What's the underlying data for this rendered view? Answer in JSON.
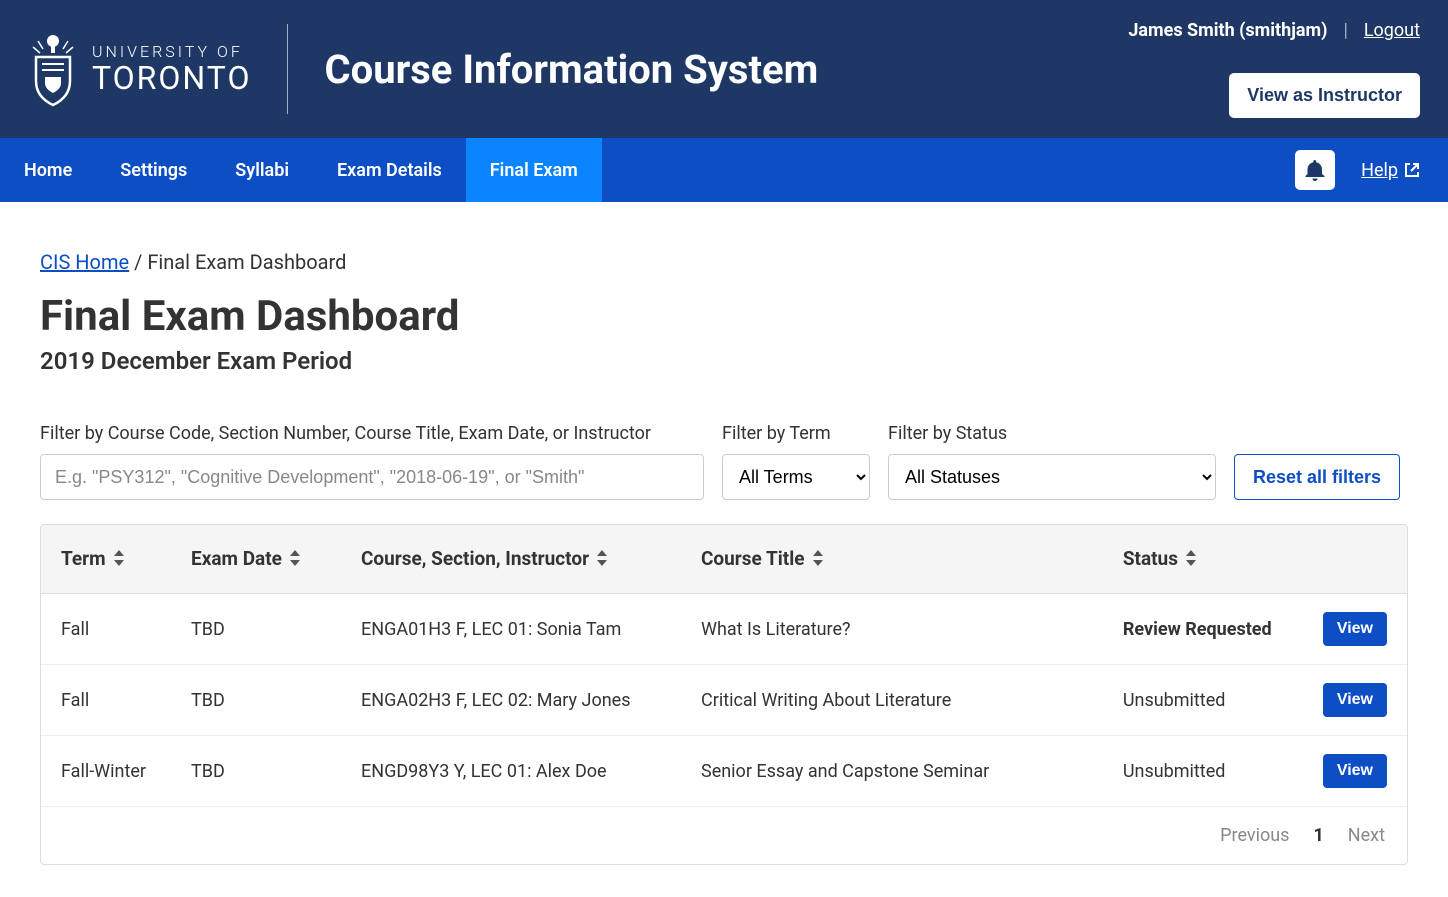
{
  "header": {
    "university_of": "UNIVERSITY OF",
    "toronto": "TORONTO",
    "app_title": "Course Information System",
    "user_display": "James Smith (smithjam)",
    "logout": "Logout",
    "view_as": "View as Instructor"
  },
  "nav": {
    "items": [
      {
        "label": "Home",
        "active": false
      },
      {
        "label": "Settings",
        "active": false
      },
      {
        "label": "Syllabi",
        "active": false
      },
      {
        "label": "Exam Details",
        "active": false
      },
      {
        "label": "Final Exam",
        "active": true
      }
    ],
    "help": "Help"
  },
  "breadcrumb": {
    "home_label": "CIS Home",
    "separator": " / ",
    "current": "Final Exam Dashboard"
  },
  "page": {
    "title": "Final Exam Dashboard",
    "subtitle": "2019 December Exam Period"
  },
  "filters": {
    "search_label": "Filter by Course Code, Section Number, Course Title, Exam Date, or Instructor",
    "search_placeholder": "E.g. \"PSY312\", \"Cognitive Development\", \"2018-06-19\", or \"Smith\"",
    "term_label": "Filter by Term",
    "term_selected": "All Terms",
    "status_label": "Filter by Status",
    "status_selected": "All Statuses",
    "reset_label": "Reset all filters"
  },
  "table": {
    "headers": {
      "term": "Term",
      "exam_date": "Exam Date",
      "course_section": "Course, Section, Instructor",
      "course_title": "Course Title",
      "status": "Status"
    },
    "view_label": "View",
    "rows": [
      {
        "term": "Fall",
        "exam_date": "TBD",
        "course": "ENGA01H3 F, LEC 01: Sonia Tam",
        "title": "What Is Literature?",
        "status": "Review Requested",
        "status_strong": true
      },
      {
        "term": "Fall",
        "exam_date": "TBD",
        "course": "ENGA02H3 F, LEC 02: Mary Jones",
        "title": "Critical Writing About Literature",
        "status": "Unsubmitted",
        "status_strong": false
      },
      {
        "term": "Fall-Winter",
        "exam_date": "TBD",
        "course": "ENGD98Y3 Y, LEC 01: Alex Doe",
        "title": "Senior Essay and Capstone Seminar",
        "status": "Unsubmitted",
        "status_strong": false
      }
    ]
  },
  "pagination": {
    "previous": "Previous",
    "page": "1",
    "next": "Next"
  }
}
